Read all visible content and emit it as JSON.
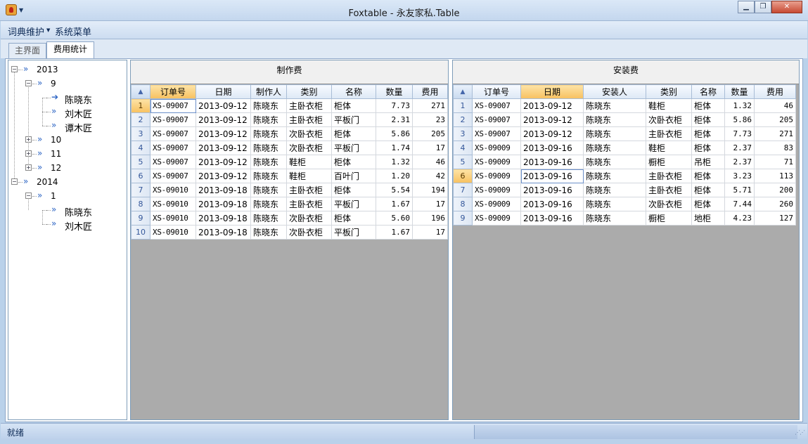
{
  "window": {
    "title": "Foxtable - 永友家私.Table"
  },
  "menu": {
    "items": [
      "词典维护",
      "系统菜单"
    ]
  },
  "tabs": [
    {
      "label": "主界面",
      "active": false
    },
    {
      "label": "费用统计",
      "active": true
    }
  ],
  "tree": {
    "nodes": [
      {
        "label": "2013",
        "level": 0,
        "expander": "−",
        "selected": false
      },
      {
        "label": "9",
        "level": 1,
        "expander": "−",
        "selected": false
      },
      {
        "label": "陈晓东",
        "level": 2,
        "expander": null,
        "selected": true
      },
      {
        "label": "刘木匠",
        "level": 2,
        "expander": null,
        "selected": false
      },
      {
        "label": "谭木匠",
        "level": 2,
        "expander": null,
        "selected": false
      },
      {
        "label": "10",
        "level": 1,
        "expander": "+",
        "selected": false
      },
      {
        "label": "11",
        "level": 1,
        "expander": "+",
        "selected": false
      },
      {
        "label": "12",
        "level": 1,
        "expander": "+",
        "selected": false
      },
      {
        "label": "2014",
        "level": 0,
        "expander": "−",
        "selected": false
      },
      {
        "label": "1",
        "level": 1,
        "expander": "−",
        "selected": false
      },
      {
        "label": "陈晓东",
        "level": 2,
        "expander": null,
        "selected": false
      },
      {
        "label": "刘木匠",
        "level": 2,
        "expander": null,
        "selected": false
      }
    ]
  },
  "production": {
    "title": "制作费",
    "columns": [
      "订单号",
      "日期",
      "制作人",
      "类别",
      "名称",
      "数量",
      "费用"
    ],
    "highlight_col": 0,
    "current_row": 0,
    "rows": [
      [
        "XS-09007",
        "2013-09-12",
        "陈晓东",
        "主卧衣柜",
        "柜体",
        "7.73",
        "271"
      ],
      [
        "XS-09007",
        "2013-09-12",
        "陈晓东",
        "主卧衣柜",
        "平板门",
        "2.31",
        "23"
      ],
      [
        "XS-09007",
        "2013-09-12",
        "陈晓东",
        "次卧衣柜",
        "柜体",
        "5.86",
        "205"
      ],
      [
        "XS-09007",
        "2013-09-12",
        "陈晓东",
        "次卧衣柜",
        "平板门",
        "1.74",
        "17"
      ],
      [
        "XS-09007",
        "2013-09-12",
        "陈晓东",
        "鞋柜",
        "柜体",
        "1.32",
        "46"
      ],
      [
        "XS-09007",
        "2013-09-12",
        "陈晓东",
        "鞋柜",
        "百叶门",
        "1.20",
        "42"
      ],
      [
        "XS-09010",
        "2013-09-18",
        "陈晓东",
        "主卧衣柜",
        "柜体",
        "5.54",
        "194"
      ],
      [
        "XS-09010",
        "2013-09-18",
        "陈晓东",
        "主卧衣柜",
        "平板门",
        "1.67",
        "17"
      ],
      [
        "XS-09010",
        "2013-09-18",
        "陈晓东",
        "次卧衣柜",
        "柜体",
        "5.60",
        "196"
      ],
      [
        "XS-09010",
        "2013-09-18",
        "陈晓东",
        "次卧衣柜",
        "平板门",
        "1.67",
        "17"
      ]
    ]
  },
  "installation": {
    "title": "安装费",
    "columns": [
      "订单号",
      "日期",
      "安装人",
      "类别",
      "名称",
      "数量",
      "费用"
    ],
    "highlight_col": 1,
    "current_row": 5,
    "rows": [
      [
        "XS-09007",
        "2013-09-12",
        "陈晓东",
        "鞋柜",
        "柜体",
        "1.32",
        "46"
      ],
      [
        "XS-09007",
        "2013-09-12",
        "陈晓东",
        "次卧衣柜",
        "柜体",
        "5.86",
        "205"
      ],
      [
        "XS-09007",
        "2013-09-12",
        "陈晓东",
        "主卧衣柜",
        "柜体",
        "7.73",
        "271"
      ],
      [
        "XS-09009",
        "2013-09-16",
        "陈晓东",
        "鞋柜",
        "柜体",
        "2.37",
        "83"
      ],
      [
        "XS-09009",
        "2013-09-16",
        "陈晓东",
        "橱柜",
        "吊柜",
        "2.37",
        "71"
      ],
      [
        "XS-09009",
        "2013-09-16",
        "陈晓东",
        "主卧衣柜",
        "柜体",
        "3.23",
        "113"
      ],
      [
        "XS-09009",
        "2013-09-16",
        "陈晓东",
        "主卧衣柜",
        "柜体",
        "5.71",
        "200"
      ],
      [
        "XS-09009",
        "2013-09-16",
        "陈晓东",
        "次卧衣柜",
        "柜体",
        "7.44",
        "260"
      ],
      [
        "XS-09009",
        "2013-09-16",
        "陈晓东",
        "橱柜",
        "地柜",
        "4.23",
        "127"
      ]
    ]
  },
  "status": {
    "text": "就绪"
  }
}
